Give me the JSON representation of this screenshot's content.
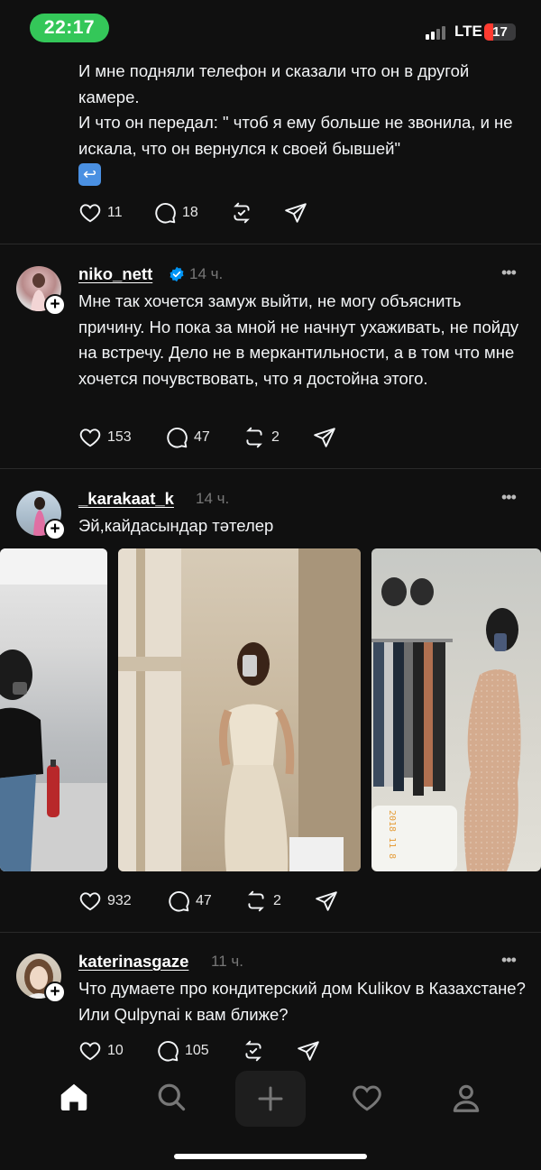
{
  "status_bar": {
    "time": "22:17",
    "network": "LTE",
    "battery": "17"
  },
  "posts": [
    {
      "text_lines": [
        "И мне подняли телефон и сказали что он в другой камере.",
        "И что он передал: \" чтоб я ему больше не звонила, и не искала, что он вернулся к своей бывшей\""
      ],
      "emoji": "↩",
      "likes": "11",
      "replies": "18"
    },
    {
      "username": "niko_nett",
      "verified": true,
      "time": "14 ч.",
      "text": "Мне так хочется замуж выйти, не могу объяснить причину. Но пока за мной не начнут ухаживать, не пойду на встречу. Дело не в меркантильности, а в том что мне хочется почувствовать, что я достойна этого.",
      "likes": "153",
      "replies": "47",
      "reposts": "2"
    },
    {
      "username": "_karakaat_k",
      "time": "14 ч.",
      "text": "Эй,кайдасындар тәтелер",
      "photo_stamp": "2018 11 8",
      "likes": "932",
      "replies": "47",
      "reposts": "2"
    },
    {
      "username": "katerinasgaze",
      "time": "11 ч.",
      "text": "Что думаете про кондитерский дом Kulikov в Казахстане? Или Qulpynai к вам ближе?",
      "likes": "10",
      "replies": "105"
    }
  ],
  "more_label": "•••",
  "icons": {
    "like": "heart-icon",
    "reply": "comment-icon",
    "repost": "repost-icon",
    "share": "send-icon",
    "nav": [
      "home-icon",
      "search-icon",
      "plus-icon",
      "heart-icon",
      "profile-icon"
    ]
  },
  "colors": {
    "time_pill": "#34c759",
    "verified": "#0095f6",
    "background": "#101010"
  }
}
